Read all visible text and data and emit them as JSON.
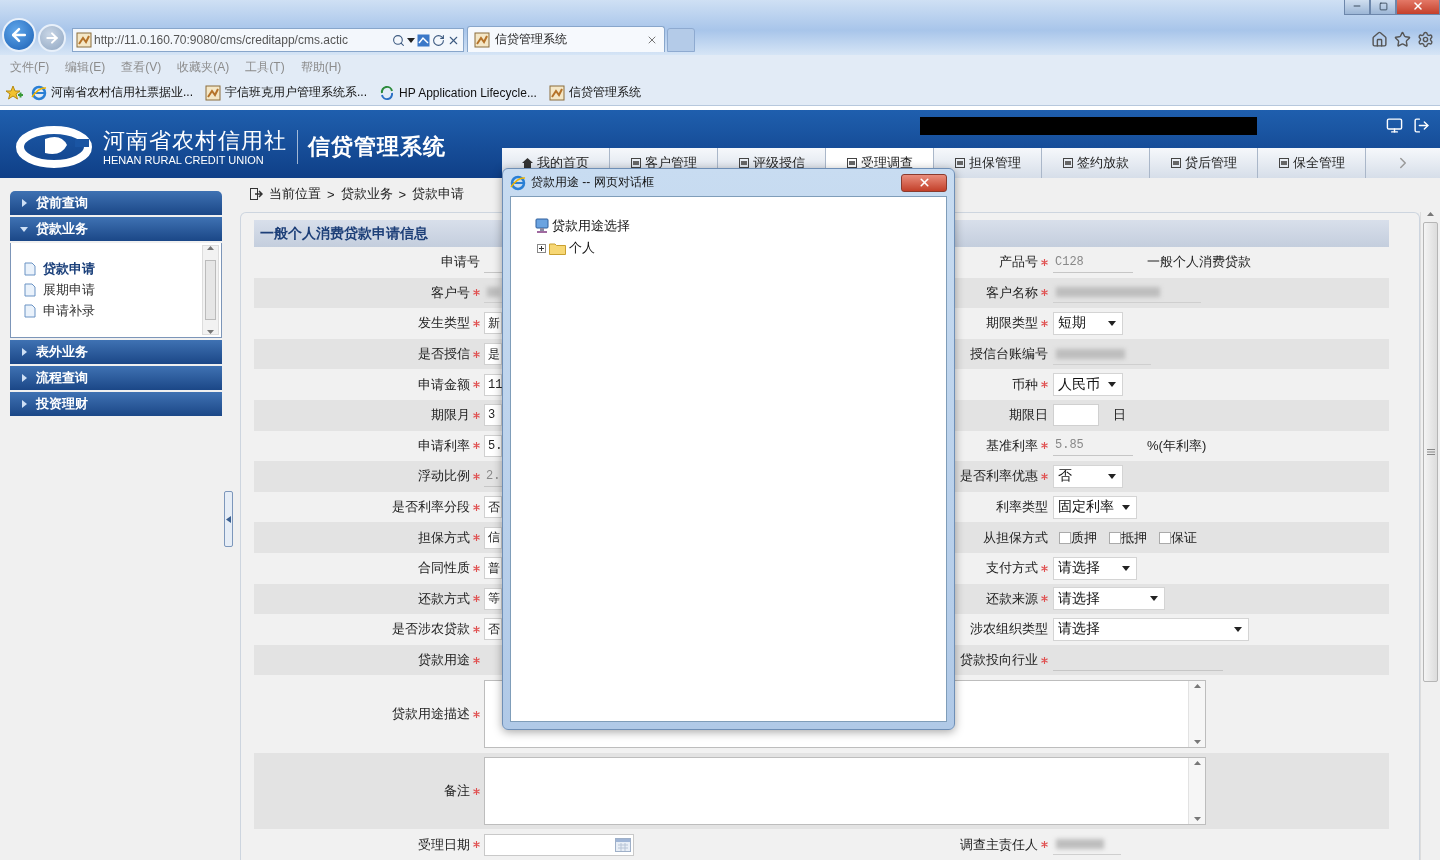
{
  "browser": {
    "address": "http://11.0.160.70:9080/cms/creditapp/cms.actic",
    "tabs": [
      {
        "title": "信贷管理系统",
        "selected": true
      }
    ],
    "menu": [
      "文件(F)",
      "编辑(E)",
      "查看(V)",
      "收藏夹(A)",
      "工具(T)",
      "帮助(H)"
    ],
    "favorites": [
      {
        "label": "河南省农村信用社票据业...",
        "kind": "ie"
      },
      {
        "label": "宇信班克用户管理系统系...",
        "kind": "page"
      },
      {
        "label": "HP Application Lifecycle...",
        "kind": "sync"
      },
      {
        "label": "信贷管理系统",
        "kind": "page"
      }
    ]
  },
  "header": {
    "org_name": "河南省农村信用社",
    "org_name_en": "HENAN RURAL CREDIT UNION",
    "system_name": "信贷管理系统",
    "nav": [
      {
        "label": "我的首页",
        "selected": false
      },
      {
        "label": "客户管理",
        "selected": false
      },
      {
        "label": "评级授信",
        "selected": false
      },
      {
        "label": "受理调查",
        "selected": true
      },
      {
        "label": "担保管理",
        "selected": false
      },
      {
        "label": "签约放款",
        "selected": false
      },
      {
        "label": "贷后管理",
        "selected": false
      },
      {
        "label": "保全管理",
        "selected": false
      }
    ]
  },
  "sidebar": {
    "sections": [
      {
        "label": "贷前查询",
        "expanded": false
      },
      {
        "label": "贷款业务",
        "expanded": true,
        "items": [
          {
            "label": "贷款申请",
            "selected": true
          },
          {
            "label": "展期申请",
            "selected": false
          },
          {
            "label": "申请补录",
            "selected": false
          }
        ]
      },
      {
        "label": "表外业务",
        "expanded": false
      },
      {
        "label": "流程查询",
        "expanded": false
      },
      {
        "label": "投资理财",
        "expanded": false
      }
    ]
  },
  "breadcrumb": {
    "items": [
      "当前位置",
      "贷款业务",
      "贷款申请"
    ],
    "separator": ">"
  },
  "form": {
    "title": "一般个人消费贷款申请信息",
    "rows": [
      {
        "kind": "pair",
        "left": {
          "label": "申请号",
          "required": false,
          "field": {
            "kind": "readonly"
          }
        },
        "right": {
          "label": "产品号",
          "required": true,
          "field": {
            "kind": "readonly",
            "value": "C128",
            "suffix": "一般个人消费贷款"
          }
        }
      },
      {
        "kind": "pair",
        "left": {
          "label": "客户号",
          "required": true,
          "field": {
            "kind": "blurred"
          }
        },
        "right": {
          "label": "客户名称",
          "required": true,
          "field": {
            "kind": "blurred"
          }
        }
      },
      {
        "kind": "pair",
        "left": {
          "label": "发生类型",
          "required": true,
          "field": {
            "kind": "input",
            "value": "新"
          }
        },
        "right": {
          "label": "期限类型",
          "required": true,
          "field": {
            "kind": "select",
            "value": "短期"
          }
        }
      },
      {
        "kind": "pair",
        "left": {
          "label": "是否授信",
          "required": true,
          "field": {
            "kind": "input",
            "value": "是"
          }
        },
        "right": {
          "label": "授信台账编号",
          "required": false,
          "field": {
            "kind": "blurred"
          }
        }
      },
      {
        "kind": "pair",
        "left": {
          "label": "申请金额",
          "required": true,
          "field": {
            "kind": "input",
            "value": "11"
          }
        },
        "right": {
          "label": "币种",
          "required": true,
          "field": {
            "kind": "select",
            "value": "人民币"
          }
        }
      },
      {
        "kind": "pair",
        "left": {
          "label": "期限月",
          "required": true,
          "field": {
            "kind": "input",
            "value": "3"
          }
        },
        "right": {
          "label": "期限日",
          "required": false,
          "field": {
            "kind": "input",
            "suffix": "日"
          }
        }
      },
      {
        "kind": "pair",
        "left": {
          "label": "申请利率",
          "required": true,
          "field": {
            "kind": "input",
            "value": "5."
          }
        },
        "right": {
          "label": "基准利率",
          "required": true,
          "field": {
            "kind": "readonly",
            "value": "5.85",
            "suffix": "%(年利率)"
          }
        }
      },
      {
        "kind": "pair",
        "left": {
          "label": "浮动比例",
          "required": true,
          "field": {
            "kind": "readonly",
            "value": "2."
          }
        },
        "right": {
          "label": "是否利率优惠",
          "required": true,
          "field": {
            "kind": "select",
            "value": "否"
          }
        }
      },
      {
        "kind": "pair",
        "left": {
          "label": "是否利率分段",
          "required": true,
          "field": {
            "kind": "input",
            "value": "否"
          }
        },
        "right": {
          "label": "利率类型",
          "required": false,
          "field": {
            "kind": "select",
            "value": "固定利率"
          }
        }
      },
      {
        "kind": "pair",
        "left": {
          "label": "担保方式",
          "required": true,
          "field": {
            "kind": "input",
            "value": "信"
          }
        },
        "right": {
          "label": "从担保方式",
          "required": false,
          "field": {
            "kind": "checkboxes",
            "options": [
              {
                "label": "质押",
                "checked": false
              },
              {
                "label": "抵押",
                "checked": false
              },
              {
                "label": "保证",
                "checked": false
              }
            ]
          }
        }
      },
      {
        "kind": "pair",
        "left": {
          "label": "合同性质",
          "required": true,
          "field": {
            "kind": "input",
            "value": "普"
          }
        },
        "right": {
          "label": "支付方式",
          "required": true,
          "field": {
            "kind": "select",
            "value": "请选择"
          }
        }
      },
      {
        "kind": "pair",
        "left": {
          "label": "还款方式",
          "required": true,
          "field": {
            "kind": "input",
            "value": "等"
          }
        },
        "right": {
          "label": "还款来源",
          "required": true,
          "field": {
            "kind": "select",
            "value": "请选择"
          }
        }
      },
      {
        "kind": "pair",
        "left": {
          "label": "是否涉农贷款",
          "required": true,
          "field": {
            "kind": "input",
            "value": "否"
          }
        },
        "right": {
          "label": "涉农组织类型",
          "required": false,
          "field": {
            "kind": "select",
            "value": "请选择"
          }
        }
      },
      {
        "kind": "pair",
        "left": {
          "label": "贷款用途",
          "required": true
        },
        "right": {
          "label": "贷款投向行业",
          "required": true,
          "field": {
            "kind": "readonly"
          }
        }
      },
      {
        "kind": "textarea",
        "left": {
          "label": "贷款用途描述",
          "required": true
        }
      },
      {
        "kind": "textarea",
        "left": {
          "label": "备注",
          "required": true
        }
      },
      {
        "kind": "pair",
        "left": {
          "label": "受理日期",
          "required": true,
          "field": {
            "kind": "date"
          }
        },
        "right": {
          "label": "调查主责任人",
          "required": true,
          "field": {
            "kind": "blurred"
          }
        }
      }
    ]
  },
  "dialog": {
    "title": "贷款用途 -- 网页对话框",
    "tree": {
      "label": "贷款用途选择",
      "children": [
        {
          "label": "个人",
          "expanded": false
        }
      ]
    }
  }
}
